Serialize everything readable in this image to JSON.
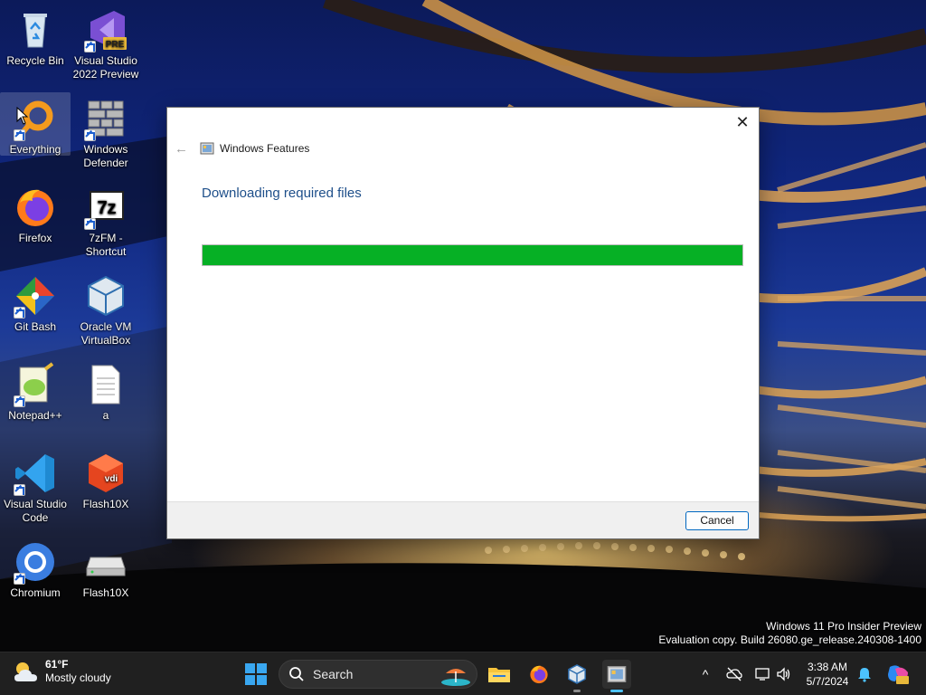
{
  "desktop": {
    "icons": [
      {
        "label": "Recycle Bin",
        "icon": "recycle-bin-icon"
      },
      {
        "label": "Visual Studio 2022 Preview",
        "icon": "visual-studio-preview-icon",
        "badge": "PRE"
      },
      {
        "label": "Everything",
        "icon": "everything-search-icon"
      },
      {
        "label": "Windows Defender",
        "icon": "windows-defender-icon"
      },
      {
        "label": "Firefox",
        "icon": "firefox-icon"
      },
      {
        "label": "7zFM - Shortcut",
        "icon": "7zip-icon",
        "glyph": "7z"
      },
      {
        "label": "Git Bash",
        "icon": "git-bash-icon"
      },
      {
        "label": "Oracle VM VirtualBox",
        "icon": "virtualbox-icon"
      },
      {
        "label": "Notepad++",
        "icon": "notepad-plus-plus-icon"
      },
      {
        "label": "a",
        "icon": "text-file-icon"
      },
      {
        "label": "Visual Studio Code",
        "icon": "vscode-icon"
      },
      {
        "label": "Flash10X",
        "icon": "flash10x-box-icon",
        "glyph": "vdi"
      },
      {
        "label": "Chromium",
        "icon": "chromium-icon"
      },
      {
        "label": "Flash10X",
        "icon": "drive-icon"
      }
    ]
  },
  "dialog": {
    "title": "Windows Features",
    "heading": "Downloading required files",
    "progress_fraction": 1.0,
    "cancel_label": "Cancel",
    "close_glyph": "✕",
    "back_glyph": "←",
    "accent_color": "#06b025"
  },
  "watermark": {
    "line1": "Windows 11 Pro Insider Preview",
    "line2": "Evaluation copy. Build 26080.ge_release.240308-1400"
  },
  "taskbar": {
    "weather": {
      "temp": "61°F",
      "condition": "Mostly cloudy",
      "icon": "partly-cloudy-icon"
    },
    "search_label": "Search",
    "apps": [
      {
        "name": "file-explorer-icon"
      },
      {
        "name": "firefox-icon"
      },
      {
        "name": "virtualbox-icon"
      },
      {
        "name": "windows-features-icon",
        "active": true
      }
    ],
    "tray": {
      "chevron": "^",
      "time": "3:38 AM",
      "date": "5/7/2024"
    }
  }
}
